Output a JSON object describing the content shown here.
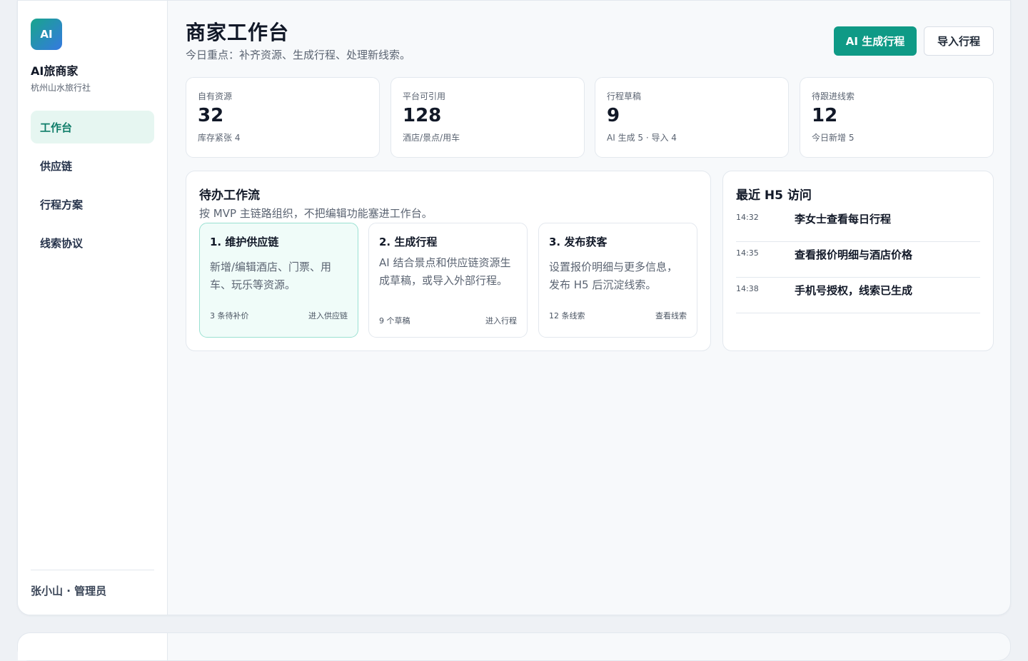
{
  "sidebar": {
    "logo": "AI",
    "brand_name": "AI旅商家",
    "brand_sub": "杭州山水旅行社",
    "items": [
      {
        "label": "工作台"
      },
      {
        "label": "供应链"
      },
      {
        "label": "行程方案"
      },
      {
        "label": "线索协议"
      }
    ],
    "user": "张小山 · 管理员"
  },
  "header": {
    "title": "商家工作台",
    "subtitle": "今日重点：补齐资源、生成行程、处理新线索。",
    "primary_button": "AI 生成行程",
    "secondary_button": "导入行程"
  },
  "stats": [
    {
      "label": "自有资源",
      "value": "32",
      "note": "库存紧张 4"
    },
    {
      "label": "平台可引用",
      "value": "128",
      "note": "酒店/景点/用车"
    },
    {
      "label": "行程草稿",
      "value": "9",
      "note": "AI 生成 5 · 导入 4"
    },
    {
      "label": "待跟进线索",
      "value": "12",
      "note": "今日新增 5"
    }
  ],
  "workflow": {
    "title": "待办工作流",
    "desc": "按 MVP 主链路组织，不把编辑功能塞进工作台。",
    "steps": [
      {
        "title": "1. 维护供应链",
        "desc": "新增/编辑酒店、门票、用车、玩乐等资源。",
        "count": "3 条待补价",
        "link": "进入供应链"
      },
      {
        "title": "2. 生成行程",
        "desc": "AI 结合景点和供应链资源生成草稿，或导入外部行程。",
        "count": "9 个草稿",
        "link": "进入行程"
      },
      {
        "title": "3. 发布获客",
        "desc": "设置报价明细与更多信息，发布 H5 后沉淀线索。",
        "count": "12 条线索",
        "link": "查看线索"
      }
    ]
  },
  "visits": {
    "title": "最近 H5 访问",
    "rows": [
      {
        "time": "14:32",
        "text": "李女士查看每日行程"
      },
      {
        "time": "14:35",
        "text": "查看报价明细与酒店价格"
      },
      {
        "time": "14:38",
        "text": "手机号授权，线索已生成"
      }
    ]
  },
  "colors": {
    "accent": "#0f9a86",
    "active_nav_bg": "#e6f6f1",
    "active_nav_text": "#0f7d69"
  }
}
